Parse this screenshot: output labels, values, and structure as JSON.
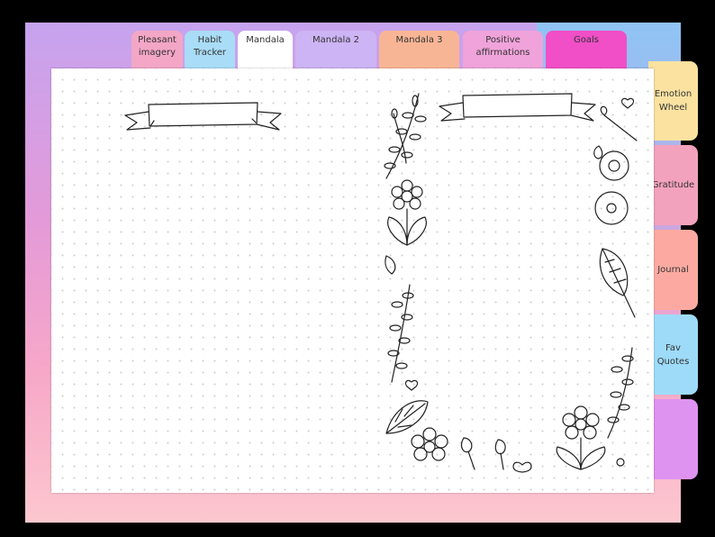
{
  "top_tabs": [
    {
      "label": "Pleasant\nimagery",
      "color": "#f3a6c6"
    },
    {
      "label": "Habit\nTracker",
      "color": "#a9dcf6"
    },
    {
      "label": "Mandala",
      "color": "#ffffff"
    },
    {
      "label": "Mandala  2",
      "color": "#cdb4f4"
    },
    {
      "label": "Mandala 3",
      "color": "#f8b596"
    },
    {
      "label": "Positive\naffirmations",
      "color": "#f0a3da"
    },
    {
      "label": "Goals",
      "color": "#f04fc7"
    }
  ],
  "side_tabs": [
    {
      "label": "Emotion\nWheel",
      "color": "#fbe2a0"
    },
    {
      "label": "Gratitude",
      "color": "#f3a2bd"
    },
    {
      "label": "Journal",
      "color": "#fcaaa1"
    },
    {
      "label": "Fav\nQuotes",
      "color": "#9edbf8"
    },
    {
      "label": "",
      "color": "#df93f0"
    }
  ]
}
